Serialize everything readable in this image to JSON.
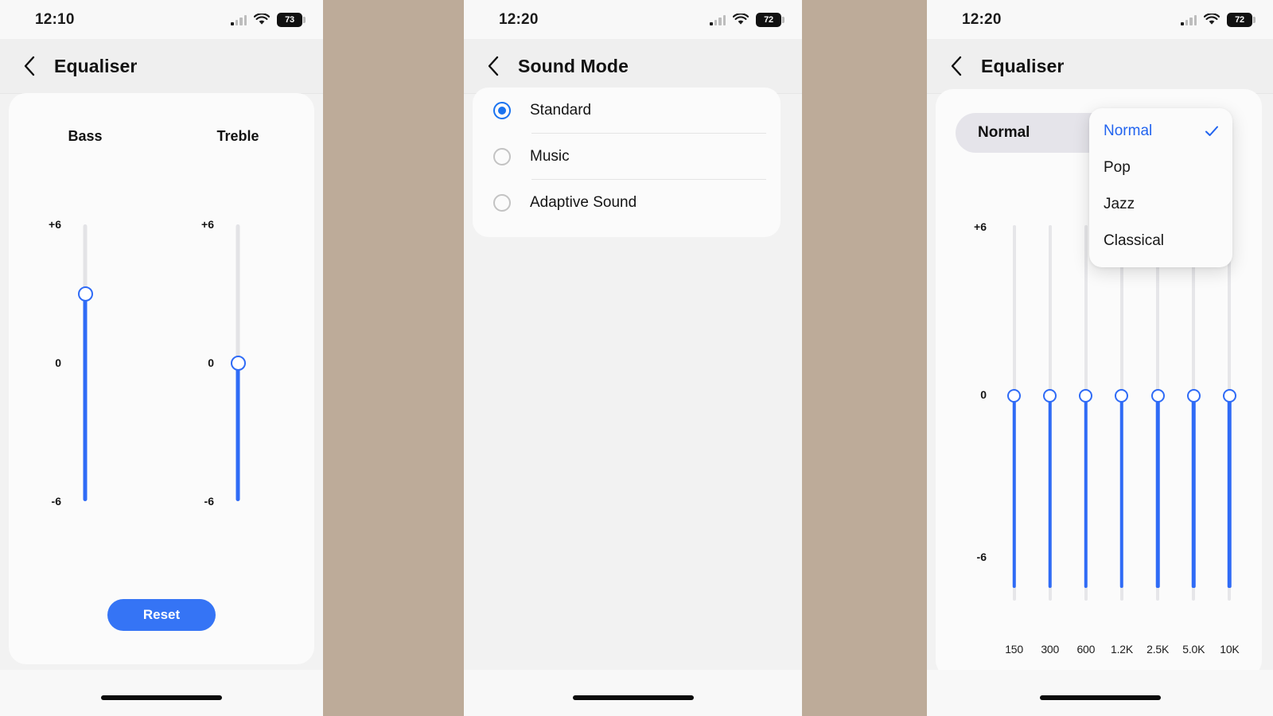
{
  "theme": {
    "accent_blue": "#2f6bf6",
    "gap_color": "#bdab99",
    "card_bg": "#fbfbfb",
    "page_bg": "#f2f2f2"
  },
  "panels": [
    {
      "status": {
        "time": "12:10",
        "battery": "73",
        "wifi_icon": "wifi-icon",
        "signal_icon": "cellular-signal-icon"
      },
      "nav": {
        "back_icon": "chevron-left-icon",
        "title": "Equaliser"
      },
      "bands": [
        {
          "label": "Bass",
          "top_tick": "+6",
          "mid_tick": "0",
          "bottom_tick": "-6",
          "value": 3
        },
        {
          "label": "Treble",
          "top_tick": "+6",
          "mid_tick": "0",
          "bottom_tick": "-6",
          "value": 0
        }
      ],
      "reset_label": "Reset"
    },
    {
      "status": {
        "time": "12:20",
        "battery": "72",
        "wifi_icon": "wifi-icon",
        "signal_icon": "cellular-signal-icon"
      },
      "nav": {
        "back_icon": "chevron-left-icon",
        "title": "Sound Mode"
      },
      "options": [
        {
          "label": "Standard",
          "selected": true
        },
        {
          "label": "Music",
          "selected": false
        },
        {
          "label": "Adaptive Sound",
          "selected": false
        }
      ]
    },
    {
      "status": {
        "time": "12:20",
        "battery": "72",
        "wifi_icon": "wifi-icon",
        "signal_icon": "cellular-signal-icon"
      },
      "nav": {
        "back_icon": "chevron-left-icon",
        "title": "Equaliser"
      },
      "preset_selected": "Normal",
      "dropdown": {
        "open": true,
        "items": [
          {
            "label": "Normal",
            "selected": true,
            "check_icon": "check-icon"
          },
          {
            "label": "Pop",
            "selected": false
          },
          {
            "label": "Jazz",
            "selected": false
          },
          {
            "label": "Classical",
            "selected": false
          }
        ]
      },
      "ticks": {
        "top": "+6",
        "mid": "0",
        "bottom": "-6"
      },
      "bands": [
        {
          "label": "150",
          "value": 0
        },
        {
          "label": "300",
          "value": 0
        },
        {
          "label": "600",
          "value": 0
        },
        {
          "label": "1.2K",
          "value": 0
        },
        {
          "label": "2.5K",
          "value": 0
        },
        {
          "label": "5.0K",
          "value": 0
        },
        {
          "label": "10K",
          "value": 0
        }
      ]
    }
  ]
}
